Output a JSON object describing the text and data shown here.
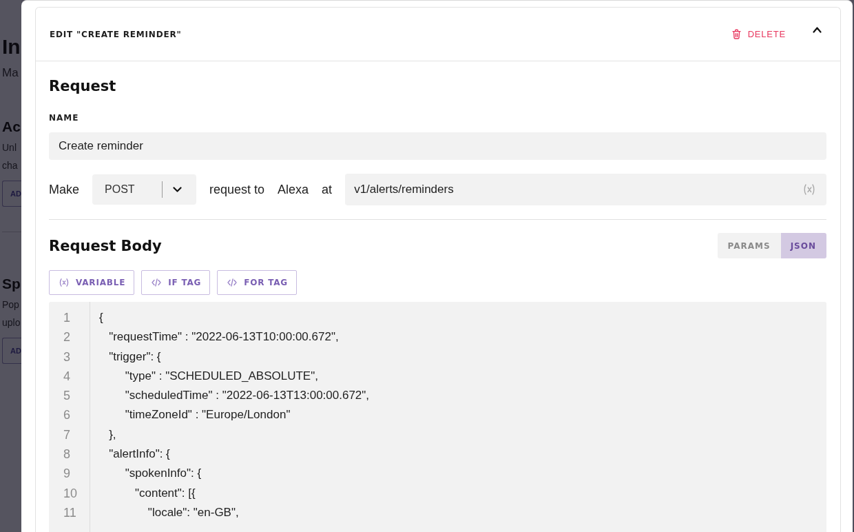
{
  "background_page": {
    "title": "In",
    "subtitle": "Ma",
    "sections": [
      {
        "title": "Ac",
        "description_lines": [
          "Unl",
          "cha"
        ],
        "button": "AD"
      },
      {
        "title": "Sp",
        "description_lines": [
          "Pop",
          "uplo"
        ],
        "button": "AD"
      }
    ]
  },
  "editor_card": {
    "title": "EDIT \"CREATE REMINDER\"",
    "delete_button": "DELETE",
    "expanded": true
  },
  "request": {
    "heading": "Request",
    "name_label": "NAME",
    "name_value": "Create reminder",
    "make_label": "Make",
    "method": "POST",
    "request_to_label": "request to",
    "service": "Alexa",
    "at_label": "at",
    "path": "v1/alerts/reminders"
  },
  "request_body": {
    "heading": "Request Body",
    "modes": [
      {
        "label": "PARAMS",
        "selected": false
      },
      {
        "label": "JSON",
        "selected": true
      }
    ],
    "insert_buttons": [
      {
        "label": "VARIABLE",
        "kind": "variable"
      },
      {
        "label": "IF TAG",
        "kind": "tag"
      },
      {
        "label": "FOR TAG",
        "kind": "tag"
      }
    ],
    "code_lines": [
      {
        "number": "1",
        "text": "{"
      },
      {
        "number": "2",
        "text": "   \"requestTime\" : \"2022-06-13T10:00:00.672\","
      },
      {
        "number": "3",
        "text": "   \"trigger\": {"
      },
      {
        "number": "4",
        "text": "        \"type\" : \"SCHEDULED_ABSOLUTE\","
      },
      {
        "number": "5",
        "text": "        \"scheduledTime\" : \"2022-06-13T13:00:00.672\","
      },
      {
        "number": "6",
        "text": "        \"timeZoneId\" : \"Europe/London\""
      },
      {
        "number": "7",
        "text": "   },"
      },
      {
        "number": "8",
        "text": "   \"alertInfo\": {"
      },
      {
        "number": "9",
        "text": "        \"spokenInfo\": {"
      },
      {
        "number": "10",
        "text": "           \"content\": [{"
      },
      {
        "number": "11",
        "text": "               \"locale\": \"en-GB\","
      }
    ]
  }
}
